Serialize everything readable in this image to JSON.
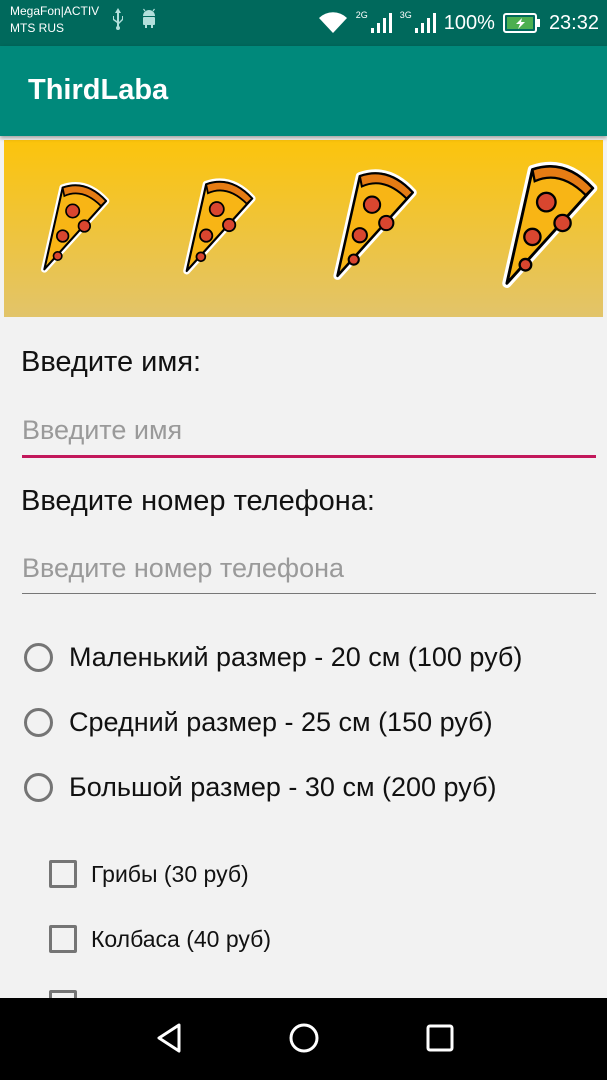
{
  "status_bar": {
    "carrier_1": "MegaFon|ACTIV",
    "carrier_2": "MTS RUS",
    "network_1": "2G",
    "network_2": "3G",
    "battery": "100%",
    "time": "23:32",
    "icons": [
      "usb-icon",
      "android-icon",
      "wifi-icon",
      "signal-icon",
      "battery-charging-icon"
    ]
  },
  "app_bar": {
    "title": "ThirdLaba"
  },
  "banner": {
    "icons": [
      "pizza-slice-icon",
      "pizza-slice-icon",
      "pizza-slice-icon",
      "pizza-slice-icon"
    ]
  },
  "form": {
    "name_label": "Введите имя:",
    "name_placeholder": "Введите имя",
    "name_value": "",
    "phone_label": "Введите номер телефона:",
    "phone_placeholder": "Введите номер телефона",
    "phone_value": "",
    "sizes": [
      {
        "label": "Маленький размер - 20 см (100 руб)",
        "checked": false
      },
      {
        "label": "Средний размер - 25 см (150 руб)",
        "checked": false
      },
      {
        "label": "Большой размер - 30 см (200 руб)",
        "checked": false
      }
    ],
    "toppings": [
      {
        "label": "Грибы (30 руб)",
        "checked": false
      },
      {
        "label": "Колбаса (40 руб)",
        "checked": false
      }
    ]
  },
  "nav_bar": {
    "icons": [
      "back-icon",
      "home-icon",
      "recents-icon"
    ]
  },
  "colors": {
    "status_bar": "#00695c",
    "app_bar": "#00897b",
    "accent": "#c2185b",
    "banner_top": "#fcc40c",
    "banner_bottom": "#e2c46a",
    "background": "#f2f2f2"
  }
}
